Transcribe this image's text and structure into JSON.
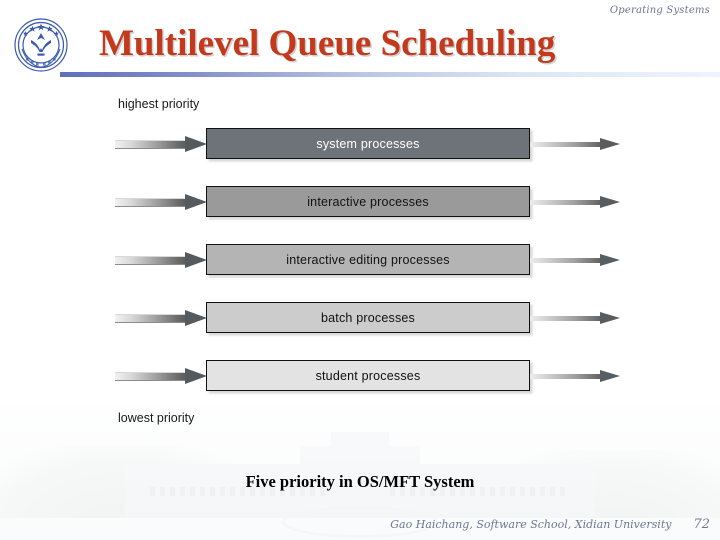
{
  "deck": {
    "course_name": "Operating Systems",
    "slide_title": "Multilevel Queue Scheduling",
    "logo_icon": "xidian-university-crest-icon"
  },
  "diagram": {
    "top_label": "highest priority",
    "bottom_label": "lowest priority",
    "arrow_in_icon": "thick-right-arrow-icon",
    "arrow_out_icon": "thin-right-arrow-icon",
    "queues": [
      {
        "label": "system processes",
        "fill": "#6e7279",
        "text_color": "#ffffff"
      },
      {
        "label": "interactive processes",
        "fill": "#9a9a9a",
        "text_color": "#111111"
      },
      {
        "label": "interactive editing processes",
        "fill": "#b4b4b4",
        "text_color": "#111111"
      },
      {
        "label": "batch processes",
        "fill": "#cccccc",
        "text_color": "#111111"
      },
      {
        "label": "student processes",
        "fill": "#e3e3e3",
        "text_color": "#111111"
      }
    ]
  },
  "caption": "Five priority in OS/MFT System",
  "footer": {
    "author_line": "Gao Haichang,  Software School,  Xidian University",
    "page_number": "72"
  }
}
